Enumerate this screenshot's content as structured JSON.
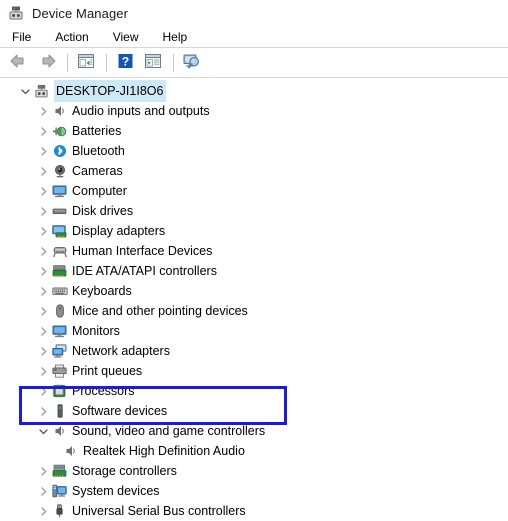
{
  "window": {
    "title": "Device Manager",
    "title_icon": "device-manager-icon"
  },
  "menu": {
    "items": [
      {
        "label": "File",
        "name": "menu-file"
      },
      {
        "label": "Action",
        "name": "menu-action"
      },
      {
        "label": "View",
        "name": "menu-view"
      },
      {
        "label": "Help",
        "name": "menu-help"
      }
    ]
  },
  "toolbar": {
    "buttons": [
      {
        "name": "back-button",
        "icon": "back-arrow-icon",
        "tooltip": "Back"
      },
      {
        "name": "forward-button",
        "icon": "forward-arrow-icon",
        "tooltip": "Forward"
      },
      {
        "name": "show-hide-console-tree-button",
        "icon": "console-tree-icon",
        "tooltip": "Show/Hide Console Tree"
      },
      {
        "name": "help-button",
        "icon": "help-question-icon",
        "tooltip": "Help"
      },
      {
        "name": "properties-button",
        "icon": "properties-icon",
        "tooltip": "Properties"
      },
      {
        "name": "scan-hardware-changes-button",
        "icon": "scan-monitor-icon",
        "tooltip": "Scan for hardware changes"
      }
    ]
  },
  "tree": {
    "root": {
      "label": "DESKTOP-JI1I8O6",
      "icon": "computer-root-icon",
      "expanded": true,
      "selected": true
    },
    "nodes": [
      {
        "label": "Audio inputs and outputs",
        "icon": "speaker-icon",
        "expanded": false,
        "depth": 1
      },
      {
        "label": "Batteries",
        "icon": "battery-icon",
        "expanded": false,
        "depth": 1
      },
      {
        "label": "Bluetooth",
        "icon": "bluetooth-icon",
        "expanded": false,
        "depth": 1
      },
      {
        "label": "Cameras",
        "icon": "camera-icon",
        "expanded": false,
        "depth": 1
      },
      {
        "label": "Computer",
        "icon": "computer-icon",
        "expanded": false,
        "depth": 1
      },
      {
        "label": "Disk drives",
        "icon": "disk-drive-icon",
        "expanded": false,
        "depth": 1
      },
      {
        "label": "Display adapters",
        "icon": "display-adapter-icon",
        "expanded": false,
        "depth": 1
      },
      {
        "label": "Human Interface Devices",
        "icon": "hid-icon",
        "expanded": false,
        "depth": 1
      },
      {
        "label": "IDE ATA/ATAPI controllers",
        "icon": "ide-controller-icon",
        "expanded": false,
        "depth": 1
      },
      {
        "label": "Keyboards",
        "icon": "keyboard-icon",
        "expanded": false,
        "depth": 1
      },
      {
        "label": "Mice and other pointing devices",
        "icon": "mouse-icon",
        "expanded": false,
        "depth": 1
      },
      {
        "label": "Monitors",
        "icon": "monitor-icon",
        "expanded": false,
        "depth": 1
      },
      {
        "label": "Network adapters",
        "icon": "network-adapter-icon",
        "expanded": false,
        "depth": 1
      },
      {
        "label": "Print queues",
        "icon": "printer-icon",
        "expanded": false,
        "depth": 1
      },
      {
        "label": "Processors",
        "icon": "processor-icon",
        "expanded": false,
        "depth": 1
      },
      {
        "label": "Software devices",
        "icon": "software-device-icon",
        "expanded": false,
        "depth": 1
      },
      {
        "label": "Sound, video and game controllers",
        "icon": "speaker-icon",
        "expanded": true,
        "depth": 1,
        "highlighted": true
      },
      {
        "label": "Realtek High Definition Audio",
        "icon": "speaker-icon",
        "expanded": null,
        "depth": 2,
        "highlighted": true
      },
      {
        "label": "Storage controllers",
        "icon": "storage-controller-icon",
        "expanded": false,
        "depth": 1
      },
      {
        "label": "System devices",
        "icon": "system-device-icon",
        "expanded": false,
        "depth": 1
      },
      {
        "label": "Universal Serial Bus controllers",
        "icon": "usb-icon",
        "expanded": false,
        "depth": 1
      }
    ]
  },
  "annotation": {
    "name": "highlight-rectangle",
    "color": "#1a1ae6",
    "targets": [
      "Sound, video and game controllers",
      "Realtek High Definition Audio"
    ]
  },
  "colors": {
    "selection": "#cde8f7",
    "annotation": "#1a1ae6",
    "separator": "#d6d6d6",
    "chevron": "#9a9a9a"
  }
}
